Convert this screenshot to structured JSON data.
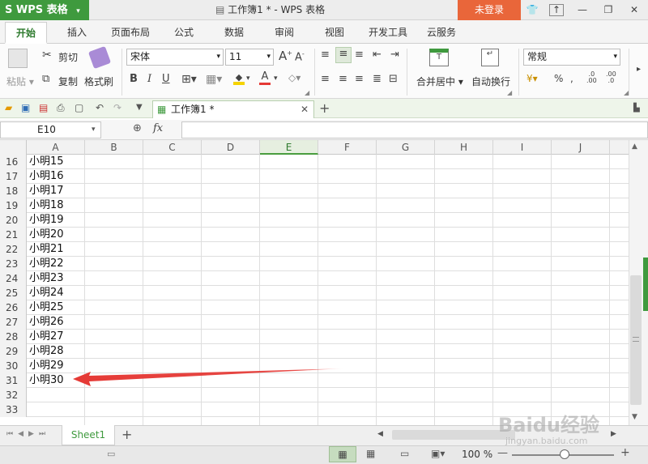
{
  "app": {
    "name": "WPS 表格",
    "doc_title": "工作簿1 * - WPS 表格",
    "login": "未登录"
  },
  "menu_tabs": [
    "开始",
    "插入",
    "页面布局",
    "公式",
    "数据",
    "审阅",
    "视图",
    "开发工具",
    "云服务"
  ],
  "ribbon": {
    "paste": "粘贴",
    "cut": "剪切",
    "copy": "复制",
    "format_painter": "格式刷",
    "font_name": "宋体",
    "font_size": "11",
    "merge_center": "合并居中",
    "wrap_text": "自动换行",
    "number_format": "常规"
  },
  "doc_tab": {
    "label": "工作簿1 *"
  },
  "formula_bar": {
    "cell_ref": "E10",
    "fx": "fx"
  },
  "columns": [
    "A",
    "B",
    "C",
    "D",
    "E",
    "F",
    "G",
    "H",
    "I",
    "J"
  ],
  "selected_column": "E",
  "rows": [
    {
      "n": "16",
      "a": "小明15"
    },
    {
      "n": "17",
      "a": "小明16"
    },
    {
      "n": "18",
      "a": "小明17"
    },
    {
      "n": "19",
      "a": "小明18"
    },
    {
      "n": "20",
      "a": "小明19"
    },
    {
      "n": "21",
      "a": "小明20"
    },
    {
      "n": "22",
      "a": "小明21"
    },
    {
      "n": "23",
      "a": "小明22"
    },
    {
      "n": "24",
      "a": "小明23"
    },
    {
      "n": "25",
      "a": "小明24"
    },
    {
      "n": "26",
      "a": "小明25"
    },
    {
      "n": "27",
      "a": "小明26"
    },
    {
      "n": "28",
      "a": "小明27"
    },
    {
      "n": "29",
      "a": "小明28"
    },
    {
      "n": "30",
      "a": "小明29"
    },
    {
      "n": "31",
      "a": "小明30"
    },
    {
      "n": "32",
      "a": ""
    },
    {
      "n": "33",
      "a": ""
    }
  ],
  "sheet_tab": "Sheet1",
  "status": {
    "zoom": "100 %"
  },
  "watermark": {
    "brand": "Baidu经验",
    "url": "jingyan.baidu.com"
  },
  "colors": {
    "accent": "#3f9a3e",
    "login": "#e9663a",
    "arrow": "#e53935"
  }
}
